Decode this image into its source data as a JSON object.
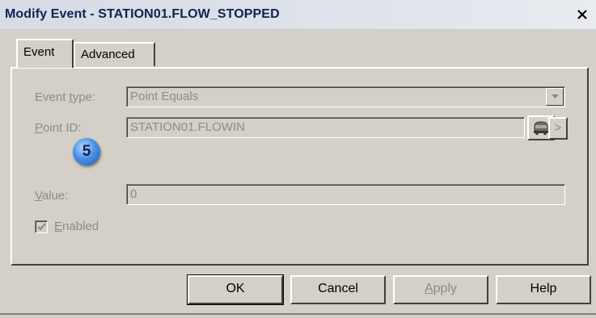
{
  "window": {
    "title": "Modify Event - STATION01.FLOW_STOPPED",
    "close_label": "X"
  },
  "tabs": [
    {
      "label": "Event",
      "active": true
    },
    {
      "label": "Advanced",
      "active": false
    }
  ],
  "form": {
    "event_type": {
      "label_prefix": "Event ",
      "label_accel": "t",
      "label_suffix": "ype:",
      "value": "Point Equals"
    },
    "point_id": {
      "label_accel": "P",
      "label_suffix": "oint ID:",
      "value": "STATION01.FLOWIN",
      "browse_icon": "tag-browser-icon",
      "more_label": ">"
    },
    "value": {
      "label_accel": "V",
      "label_suffix": "alue:",
      "value": "0"
    },
    "enabled": {
      "label_accel": "E",
      "label_suffix": "nabled",
      "checked": true
    }
  },
  "callout": {
    "number": "5"
  },
  "buttons": {
    "ok": "OK",
    "cancel": "Cancel",
    "apply_accel": "A",
    "apply_suffix": "pply",
    "help": "Help"
  }
}
